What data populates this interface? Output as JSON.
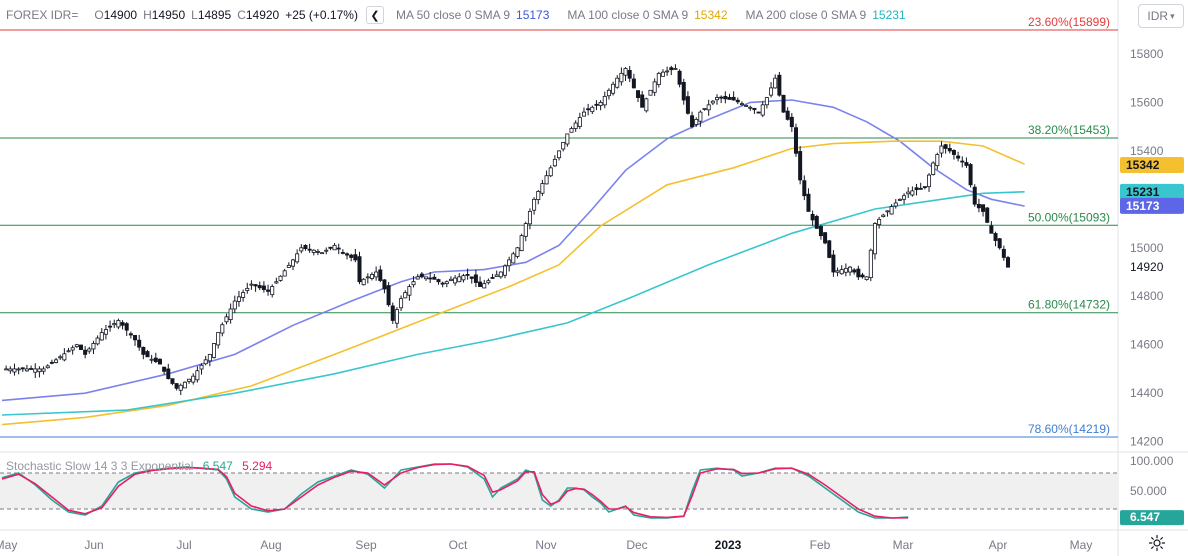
{
  "symbol": "FOREX IDR=",
  "currency_button": "IDR",
  "ohlc": {
    "o_label": "O",
    "o": "14900",
    "h_label": "H",
    "h": "14950",
    "l_label": "L",
    "l": "14895",
    "c_label": "C",
    "c": "14920",
    "change": "+25 (+0.17%)"
  },
  "collapse_icon": "chevron-left-icon",
  "ma_legend": [
    {
      "label": "MA 50 close 0 SMA 9",
      "value": "15173",
      "color": "#7b83eb"
    },
    {
      "label": "MA 100 close 0 SMA 9",
      "value": "15342",
      "color": "#f5c030"
    },
    {
      "label": "MA 200 close 0 SMA 9",
      "value": "15231",
      "color": "#3ac6cf"
    }
  ],
  "stoch_legend": {
    "label": "Stochastic Slow 14 3 3 Exponential",
    "k": "6.547",
    "d": "5.294",
    "k_color": "#26a69a",
    "d_color": "#e91e63"
  },
  "colors": {
    "fib_red": "#e23b3b",
    "fib_green": "#2a8a4a",
    "fib_blue": "#3f7fd0",
    "candle": "#131722",
    "grid_axis": "#787b86"
  },
  "chart_data": [
    {
      "type": "candlestick",
      "title": "",
      "ylim": [
        14160,
        15960
      ],
      "y_ticks": [
        "15800",
        "15600",
        "15400",
        "15200",
        "15000",
        "14800",
        "14600",
        "14400",
        "14200"
      ],
      "x_ticks": [
        "May",
        "Jun",
        "Jul",
        "Aug",
        "Sep",
        "Oct",
        "Nov",
        "Dec",
        "2023",
        "Feb",
        "Mar",
        "Apr",
        "May"
      ],
      "fib_levels": [
        {
          "label": "23.60%(15899)",
          "value": 15899,
          "color": "#e23b3b"
        },
        {
          "label": "38.20%(15453)",
          "value": 15453,
          "color": "#2a8a4a"
        },
        {
          "label": "50.00%(15093)",
          "value": 15093,
          "color": "#2a8a4a"
        },
        {
          "label": "61.80%(14732)",
          "value": 14732,
          "color": "#2a8a4a"
        },
        {
          "label": "78.60%(14219)",
          "value": 14219,
          "color": "#3f7fd0"
        }
      ],
      "price_badges": [
        {
          "value": "15342",
          "bg": "#f5c030",
          "fg": "#131722"
        },
        {
          "value": "15231",
          "bg": "#3ac6cf",
          "fg": "#131722"
        },
        {
          "value": "15173",
          "bg": "#5d66e6",
          "fg": "#ffffff"
        }
      ],
      "last_price": "14920",
      "close_path": [
        [
          0,
          14500
        ],
        [
          5,
          14500
        ],
        [
          10,
          14500
        ],
        [
          14,
          14550
        ],
        [
          18,
          14600
        ],
        [
          20,
          14560
        ],
        [
          24,
          14650
        ],
        [
          28,
          14700
        ],
        [
          32,
          14620
        ],
        [
          34,
          14560
        ],
        [
          38,
          14520
        ],
        [
          40,
          14460
        ],
        [
          42,
          14420
        ],
        [
          46,
          14470
        ],
        [
          50,
          14560
        ],
        [
          52,
          14650
        ],
        [
          56,
          14780
        ],
        [
          60,
          14850
        ],
        [
          64,
          14820
        ],
        [
          66,
          14860
        ],
        [
          70,
          14950
        ],
        [
          72,
          15000
        ],
        [
          75,
          14990
        ],
        [
          77,
          14980
        ],
        [
          80,
          15010
        ],
        [
          82,
          14980
        ],
        [
          85,
          14950
        ],
        [
          86,
          14860
        ],
        [
          88,
          14880
        ],
        [
          90,
          14900
        ],
        [
          92,
          14830
        ],
        [
          94,
          14700
        ],
        [
          96,
          14790
        ],
        [
          98,
          14840
        ],
        [
          100,
          14880
        ],
        [
          102,
          14880
        ],
        [
          104,
          14870
        ],
        [
          106,
          14850
        ],
        [
          108,
          14870
        ],
        [
          112,
          14890
        ],
        [
          115,
          14840
        ],
        [
          120,
          14900
        ],
        [
          124,
          15000
        ],
        [
          128,
          15200
        ],
        [
          132,
          15330
        ],
        [
          134,
          15400
        ],
        [
          136,
          15470
        ],
        [
          140,
          15560
        ],
        [
          144,
          15600
        ],
        [
          148,
          15700
        ],
        [
          150,
          15740
        ],
        [
          154,
          15580
        ],
        [
          158,
          15720
        ],
        [
          162,
          15740
        ],
        [
          164,
          15610
        ],
        [
          166,
          15500
        ],
        [
          168,
          15560
        ],
        [
          172,
          15620
        ],
        [
          176,
          15610
        ],
        [
          180,
          15580
        ],
        [
          182,
          15560
        ],
        [
          184,
          15620
        ],
        [
          186,
          15700
        ],
        [
          188,
          15560
        ],
        [
          190,
          15500
        ],
        [
          192,
          15280
        ],
        [
          194,
          15150
        ],
        [
          196,
          15080
        ],
        [
          198,
          15020
        ],
        [
          200,
          14900
        ],
        [
          204,
          14920
        ],
        [
          206,
          14880
        ],
        [
          208,
          14880
        ],
        [
          210,
          15100
        ],
        [
          214,
          15170
        ],
        [
          218,
          15230
        ],
        [
          222,
          15250
        ],
        [
          224,
          15350
        ],
        [
          226,
          15420
        ],
        [
          228,
          15400
        ],
        [
          230,
          15370
        ],
        [
          232,
          15340
        ],
        [
          234,
          15180
        ],
        [
          236,
          15150
        ],
        [
          238,
          15060
        ],
        [
          240,
          15000
        ],
        [
          242,
          14920
        ]
      ]
    },
    {
      "type": "line",
      "title": "",
      "ylim": [
        0,
        100
      ],
      "y_ticks": [
        "100.000",
        "50.000"
      ],
      "bands": [
        80,
        20
      ],
      "series": [
        {
          "name": "%K",
          "color": "#26a69a",
          "points": [
            [
              0,
              72
            ],
            [
              4,
              80
            ],
            [
              8,
              60
            ],
            [
              12,
              35
            ],
            [
              16,
              15
            ],
            [
              20,
              10
            ],
            [
              24,
              25
            ],
            [
              28,
              65
            ],
            [
              32,
              80
            ],
            [
              36,
              85
            ],
            [
              40,
              88
            ],
            [
              44,
              90
            ],
            [
              48,
              88
            ],
            [
              52,
              85
            ],
            [
              54,
              70
            ],
            [
              56,
              40
            ],
            [
              60,
              20
            ],
            [
              64,
              15
            ],
            [
              68,
              20
            ],
            [
              72,
              45
            ],
            [
              76,
              65
            ],
            [
              80,
              75
            ],
            [
              84,
              85
            ],
            [
              88,
              78
            ],
            [
              92,
              55
            ],
            [
              96,
              85
            ],
            [
              100,
              90
            ],
            [
              104,
              95
            ],
            [
              108,
              95
            ],
            [
              112,
              90
            ],
            [
              116,
              70
            ],
            [
              118,
              40
            ],
            [
              120,
              55
            ],
            [
              124,
              70
            ],
            [
              126,
              85
            ],
            [
              128,
              80
            ],
            [
              130,
              35
            ],
            [
              132,
              25
            ],
            [
              134,
              35
            ],
            [
              136,
              55
            ],
            [
              138,
              55
            ],
            [
              140,
              52
            ],
            [
              142,
              40
            ],
            [
              144,
              30
            ],
            [
              146,
              15
            ],
            [
              148,
              20
            ],
            [
              150,
              25
            ],
            [
              152,
              10
            ],
            [
              156,
              5
            ],
            [
              160,
              5
            ],
            [
              164,
              8
            ],
            [
              166,
              50
            ],
            [
              168,
              85
            ],
            [
              172,
              88
            ],
            [
              176,
              85
            ],
            [
              178,
              75
            ],
            [
              182,
              80
            ],
            [
              186,
              88
            ],
            [
              190,
              88
            ],
            [
              194,
              75
            ],
            [
              198,
              55
            ],
            [
              202,
              35
            ],
            [
              206,
              15
            ],
            [
              210,
              5
            ],
            [
              214,
              5
            ],
            [
              218,
              6.5
            ]
          ]
        },
        {
          "name": "%D",
          "color": "#e91e63",
          "points": [
            [
              0,
              70
            ],
            [
              4,
              78
            ],
            [
              8,
              62
            ],
            [
              12,
              40
            ],
            [
              16,
              18
            ],
            [
              20,
              12
            ],
            [
              24,
              22
            ],
            [
              28,
              58
            ],
            [
              32,
              78
            ],
            [
              36,
              84
            ],
            [
              40,
              87
            ],
            [
              44,
              89
            ],
            [
              48,
              88
            ],
            [
              52,
              86
            ],
            [
              54,
              74
            ],
            [
              56,
              46
            ],
            [
              60,
              25
            ],
            [
              64,
              17
            ],
            [
              68,
              20
            ],
            [
              72,
              40
            ],
            [
              76,
              60
            ],
            [
              80,
              73
            ],
            [
              84,
              83
            ],
            [
              88,
              80
            ],
            [
              92,
              60
            ],
            [
              96,
              80
            ],
            [
              100,
              89
            ],
            [
              104,
              94
            ],
            [
              108,
              95
            ],
            [
              112,
              91
            ],
            [
              116,
              76
            ],
            [
              118,
              48
            ],
            [
              120,
              52
            ],
            [
              124,
              67
            ],
            [
              126,
              82
            ],
            [
              128,
              82
            ],
            [
              130,
              44
            ],
            [
              132,
              28
            ],
            [
              134,
              33
            ],
            [
              136,
              50
            ],
            [
              138,
              54
            ],
            [
              140,
              53
            ],
            [
              142,
              44
            ],
            [
              144,
              33
            ],
            [
              146,
              20
            ],
            [
              148,
              20
            ],
            [
              150,
              24
            ],
            [
              152,
              14
            ],
            [
              156,
              7
            ],
            [
              160,
              6
            ],
            [
              164,
              8
            ],
            [
              166,
              42
            ],
            [
              168,
              80
            ],
            [
              172,
              87
            ],
            [
              176,
              86
            ],
            [
              178,
              79
            ],
            [
              182,
              80
            ],
            [
              186,
              87
            ],
            [
              190,
              88
            ],
            [
              194,
              78
            ],
            [
              198,
              60
            ],
            [
              202,
              40
            ],
            [
              206,
              20
            ],
            [
              210,
              8
            ],
            [
              214,
              5
            ],
            [
              218,
              5.3
            ]
          ]
        }
      ],
      "last_value": "6.547"
    }
  ]
}
